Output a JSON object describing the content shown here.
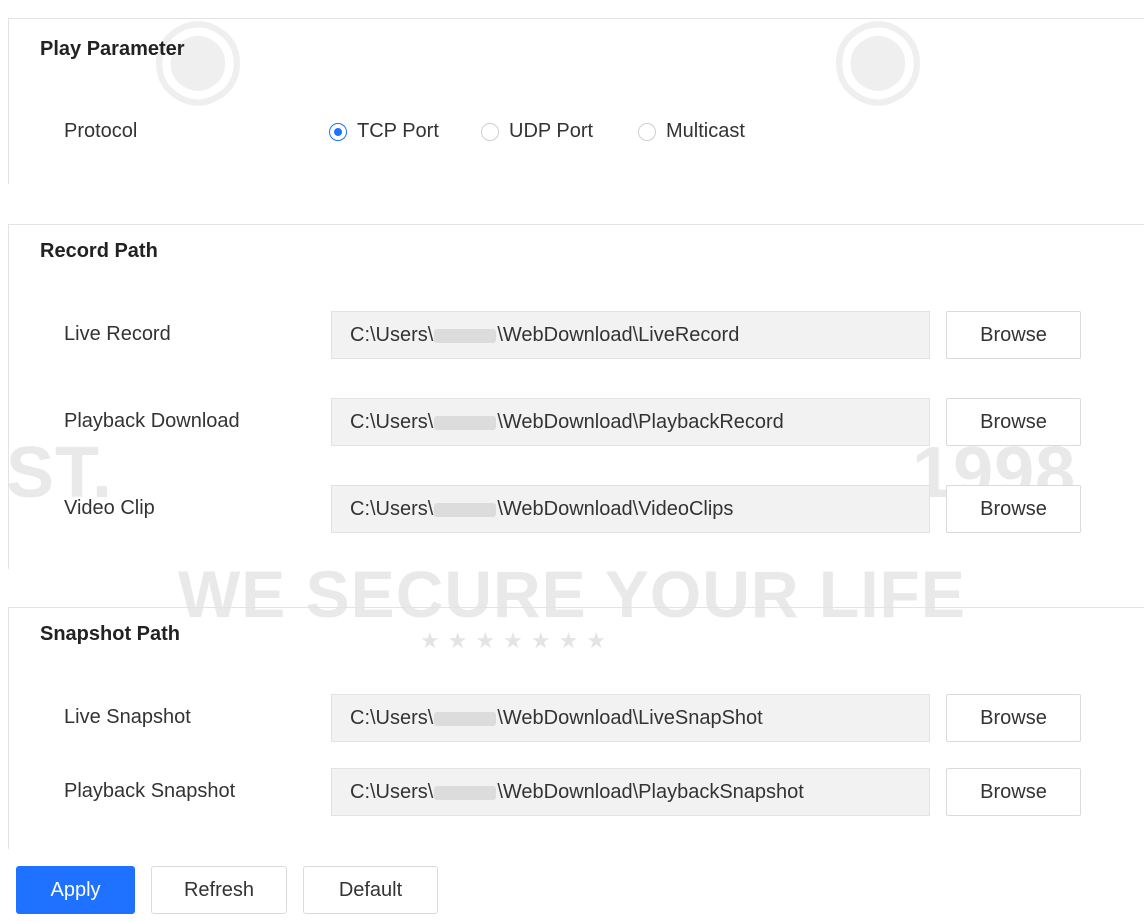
{
  "watermark": {
    "slogan": "WE SECURE YOUR LIFE",
    "est": "ST.",
    "year": "1998",
    "stars": "★★★★★★★"
  },
  "play_parameter": {
    "title": "Play Parameter",
    "protocol_label": "Protocol",
    "options": [
      {
        "label": "TCP Port",
        "checked": true
      },
      {
        "label": "UDP Port",
        "checked": false
      },
      {
        "label": "Multicast",
        "checked": false
      }
    ]
  },
  "record_path": {
    "title": "Record Path",
    "rows": [
      {
        "label": "Live Record",
        "path_prefix": "C:\\Users\\",
        "path_suffix": "\\WebDownload\\LiveRecord",
        "button": "Browse"
      },
      {
        "label": "Playback Download",
        "path_prefix": "C:\\Users\\",
        "path_suffix": "\\WebDownload\\PlaybackRecord",
        "button": "Browse"
      },
      {
        "label": "Video Clip",
        "path_prefix": "C:\\Users\\",
        "path_suffix": "\\WebDownload\\VideoClips",
        "button": "Browse"
      }
    ]
  },
  "snapshot_path": {
    "title": "Snapshot Path",
    "rows": [
      {
        "label": "Live Snapshot",
        "path_prefix": "C:\\Users\\",
        "path_suffix": "\\WebDownload\\LiveSnapShot",
        "button": "Browse"
      },
      {
        "label": "Playback Snapshot",
        "path_prefix": "C:\\Users\\",
        "path_suffix": "\\WebDownload\\PlaybackSnapshot",
        "button": "Browse"
      }
    ]
  },
  "actions": {
    "apply": "Apply",
    "refresh": "Refresh",
    "default": "Default"
  },
  "colors": {
    "accent": "#1f72ff",
    "field_bg": "#f2f2f2",
    "border": "#dadada"
  }
}
